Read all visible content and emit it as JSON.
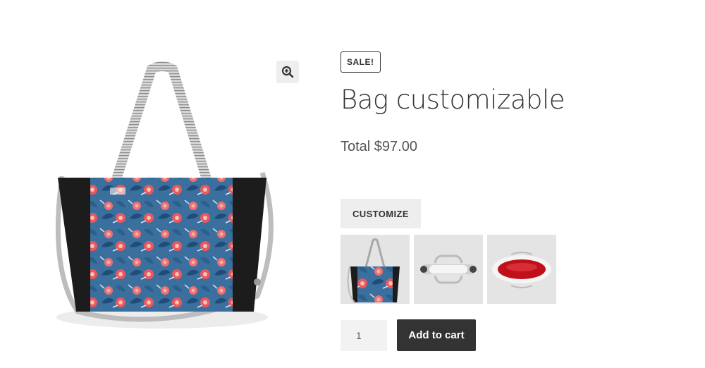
{
  "product": {
    "badge": "SALE!",
    "title": "Bag customizable",
    "price_label": "Total $97.00"
  },
  "gallery": {
    "zoom_icon": "magnify-plus-icon",
    "main_image": "floral-tote-bag-image",
    "thumbnails": [
      {
        "name": "thumbnail-front-bag"
      },
      {
        "name": "thumbnail-handle"
      },
      {
        "name": "thumbnail-red-interior"
      }
    ]
  },
  "actions": {
    "customize_label": "CUSTOMIZE",
    "quantity": "1",
    "add_to_cart_label": "Add to cart"
  },
  "colors": {
    "button_dark": "#333333",
    "button_light": "#eeeeee"
  }
}
